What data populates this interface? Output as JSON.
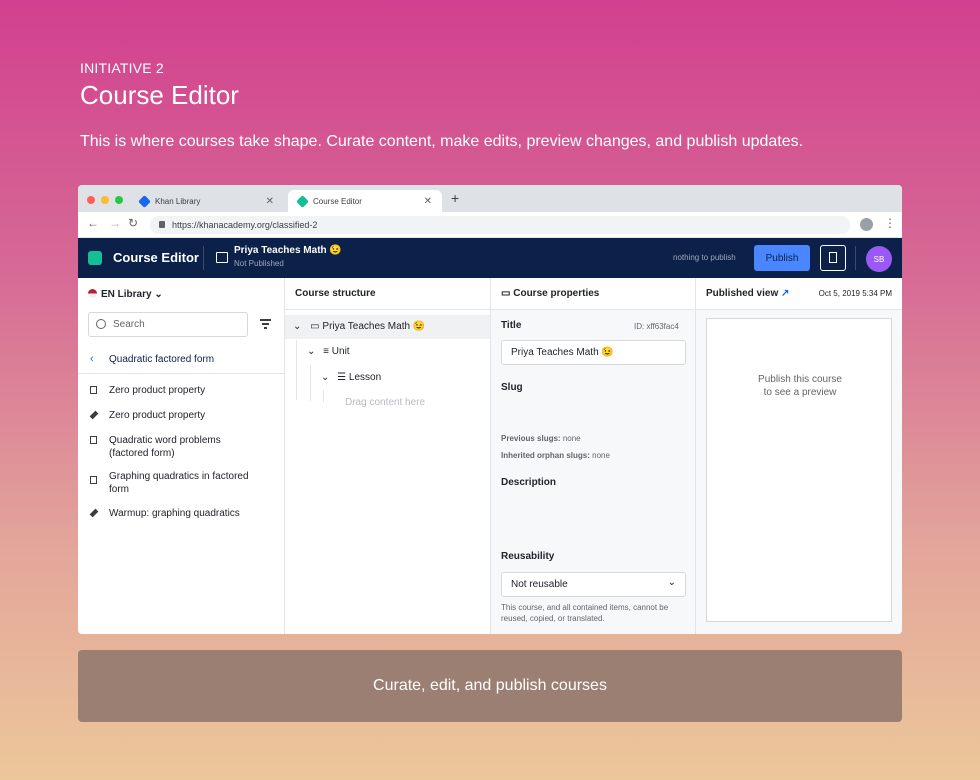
{
  "intro": {
    "kicker": "INITIATIVE 2",
    "title": "Course Editor",
    "description": "This is where courses take shape. Curate content, make edits, preview changes, and publish updates."
  },
  "browser": {
    "tabs": [
      {
        "label": "Khan Library",
        "active": false
      },
      {
        "label": "Course Editor",
        "active": true
      }
    ],
    "new_tab": "+",
    "url": "https://khanacademy.org/classified-2"
  },
  "app": {
    "name": "Course Editor",
    "course_title": "Priya Teaches Math 😉",
    "course_status": "Not Published",
    "publish_status": "nothing to publish",
    "publish_label": "Publish",
    "avatar_initials": "SB",
    "colors": {
      "navbar": "#0b2149",
      "accent": "#1865f2",
      "publish": "#4a86ff",
      "logo": "#14bf96",
      "avatar": "#9a59f5"
    }
  },
  "library": {
    "language_label": "EN Library",
    "search_placeholder": "Search",
    "breadcrumb": "Quadratic factored form",
    "items": [
      {
        "label": "Zero product property",
        "icon": "article-icon"
      },
      {
        "label": "Zero product property",
        "icon": "exercise-icon"
      },
      {
        "label": "Quadratic word problems (factored form)",
        "icon": "article-icon"
      },
      {
        "label": "Graphing quadratics in factored form",
        "icon": "article-icon"
      },
      {
        "label": "Warmup: graphing quadratics",
        "icon": "exercise-icon"
      }
    ]
  },
  "structure": {
    "header": "Course structure",
    "course": "Priya Teaches Math 😉",
    "unit": "Unit",
    "lesson": "Lesson",
    "drop_hint": "Drag content here"
  },
  "properties": {
    "header": "Course properties",
    "title_label": "Title",
    "id_text": "ID: xff63fac4",
    "title_value": "Priya Teaches Math 😉",
    "slug_label": "Slug",
    "previous_slugs_label": "Previous slugs:",
    "previous_slugs_value": "none",
    "orphan_slugs_label": "Inherited orphan slugs:",
    "orphan_slugs_value": "none",
    "description_label": "Description",
    "reusability_label": "Reusability",
    "reusability_value": "Not reusable",
    "reusability_help": "This course, and all contained items, cannot be reused, copied, or translated."
  },
  "published": {
    "header": "Published view",
    "date": "Oct 5, 2019 5:34 PM",
    "preview_line1": "Publish this course",
    "preview_line2": "to see a preview"
  },
  "caption": "Curate, edit, and publish courses"
}
